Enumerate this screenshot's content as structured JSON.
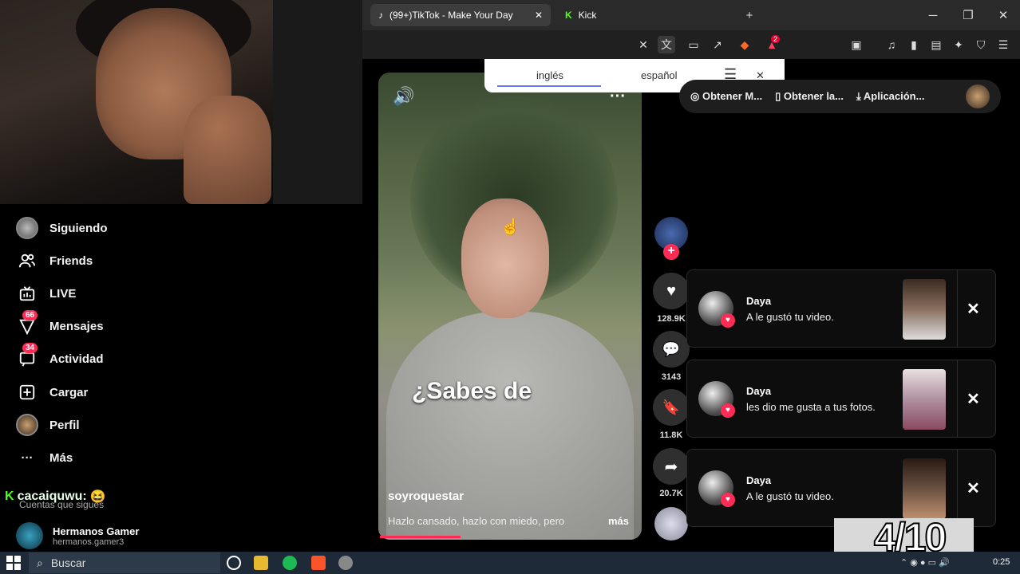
{
  "browser": {
    "tabs": [
      {
        "label": "(99+)TikTok - Make Your Day",
        "icon": "tiktok-icon"
      },
      {
        "label": "Kick",
        "icon": "kick-icon"
      }
    ],
    "new_tab": "+",
    "window_controls": {
      "minimize": "─",
      "maximize": "❐",
      "close": "✕"
    },
    "shield_count": "2"
  },
  "translate": {
    "lang1": "inglés",
    "lang2": "español",
    "menu": "☰",
    "close": "✕"
  },
  "sidebar": {
    "items": [
      {
        "label": "Siguiendo",
        "icon": "avatar-icon"
      },
      {
        "label": "Friends",
        "icon": "friends-icon"
      },
      {
        "label": "LIVE",
        "icon": "live-icon"
      },
      {
        "label": "Mensajes",
        "icon": "messages-icon",
        "badge": "66"
      },
      {
        "label": "Actividad",
        "icon": "activity-icon",
        "badge": "34"
      },
      {
        "label": "Cargar",
        "icon": "upload-icon"
      },
      {
        "label": "Perfil",
        "icon": "profile-icon"
      },
      {
        "label": "Más",
        "icon": "more-icon"
      }
    ],
    "following_title": "Cuentas que sigues",
    "following": [
      {
        "name": "Hermanos Gamer",
        "handle": "hermanos.gamer3"
      }
    ]
  },
  "kick_overlay": {
    "username": "cacaiquwu:",
    "emote": "😆"
  },
  "video": {
    "caption": "¿Sabes de",
    "author": "soyroquestar",
    "description": "Hazlo cansado, hazlo con miedo, pero",
    "more": "más",
    "likes": "128.9K",
    "comments": "3143",
    "saves": "11.8K",
    "shares": "20.7K",
    "progress": 0.31
  },
  "top_bar": {
    "items": [
      "Obtener M...",
      "Obtener la...",
      "Aplicación..."
    ]
  },
  "notifications": [
    {
      "name": "Daya",
      "message": "A le gustó tu video.",
      "close": "✕",
      "thumb_color": "#8a7060"
    },
    {
      "name": "Daya",
      "message": "les dio me gusta a tus fotos.",
      "close": "✕",
      "thumb_color": "#b090a0"
    },
    {
      "name": "Daya",
      "message": "A le gustó tu video.",
      "close": "✕",
      "thumb_color": "#6a5040"
    }
  ],
  "counter": "4/10",
  "taskbar": {
    "search_placeholder": "Buscar",
    "time": "0:25"
  },
  "colors": {
    "accent": "#fe2c55",
    "kick": "#53fc18",
    "translate_underline": "#6c7be8"
  }
}
